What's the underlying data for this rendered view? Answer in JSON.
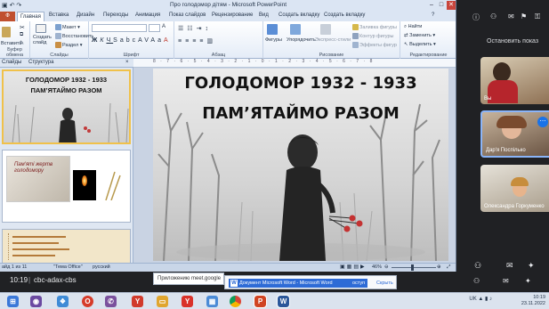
{
  "window": {
    "title": "Про голодомор дітям - Microsoft PowerPoint"
  },
  "ribbon": {
    "file_tab": "Ф",
    "tabs": [
      "Главная",
      "Вставка",
      "Дизайн",
      "Переходы",
      "Анимация",
      "Показ слайдов",
      "Рецензирование",
      "Вид",
      "Создать вкладку",
      "Создать вкладку"
    ],
    "groups": {
      "clipboard": "Буфер обмена",
      "slides": "Слайды",
      "font": "Шрифт",
      "paragraph": "Абзац",
      "drawing": "Рисование",
      "editing": "Редактирование"
    },
    "buttons": {
      "insert": "Вставить",
      "create_slide": "Создать слайд",
      "layout": "Макет",
      "reset": "Восстановить",
      "section": "Раздел",
      "shapes": "Фигуры",
      "arrange": "Упорядочить",
      "quick_styles": "Экспресс-стили",
      "shape_fill": "Заливка фигуры",
      "shape_outline": "Контур фигуры",
      "shape_effects": "Эффекты фигур",
      "find": "Найти",
      "replace": "Заменить",
      "select": "Выделить"
    }
  },
  "panes": {
    "slides_tab": "Слайды",
    "structure_tab": "Структура"
  },
  "ruler_text": "8 · 7 · 6 · 5 · 4 · 3 · 2 · 1 · 0 · 1 · 2 · 3 · 4 · 5 · 6 · 7 · 8",
  "slide": {
    "title_line1": "ГОЛОДОМОР 1932 - 1933",
    "title_line2": "ПАМ’ЯТАЙМО РАЗОМ"
  },
  "thumbnails": {
    "t1_line1": "ГОЛОДОМОР 1932 - 1933",
    "t1_line2": "ПАМ’ЯТАЙМО РАЗОМ",
    "t2_text": "Пам'яті жертв голодомору"
  },
  "status": {
    "slide_info": "айд 1 из 11",
    "theme": "\"Тема Office\"",
    "language": "русский",
    "zoom": "46%"
  },
  "meet": {
    "stop_presenting": "Остановить показ",
    "participants": [
      {
        "name": "Вы"
      },
      {
        "name": "Дар'я Поспілько"
      },
      {
        "name": "Олександра Горкуменко"
      }
    ],
    "time": "10:19",
    "meeting_code": "cbc-adax-cbs"
  },
  "notification": {
    "text": "Приложению meet.google"
  },
  "word_popup": {
    "text": "Документ Microsoft Word - Microsoft Word",
    "access": "оступ",
    "hide": "Скрыть"
  },
  "taskbar": {
    "lang": "UK",
    "clock_time": "10:19",
    "clock_date": "23.11.2022"
  },
  "colors": {
    "accent_blue": "#2e6bd6",
    "file_tab": "#c0502f",
    "meet_bg": "#202124"
  }
}
